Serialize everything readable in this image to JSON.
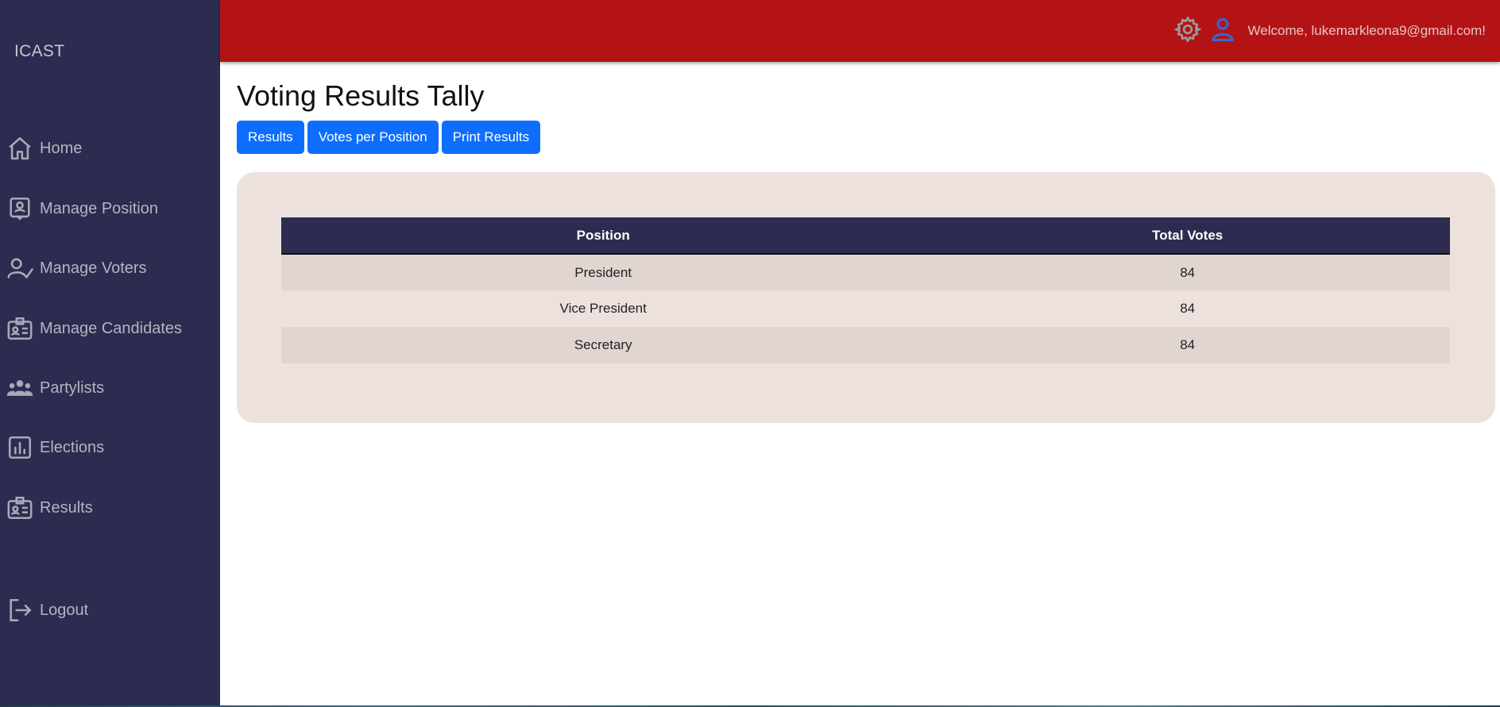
{
  "sidebar": {
    "brand": "ICAST",
    "items": [
      {
        "label": "Home",
        "icon": "home-icon"
      },
      {
        "label": "Manage Position",
        "icon": "position-badge-icon"
      },
      {
        "label": "Manage Voters",
        "icon": "user-check-icon"
      },
      {
        "label": "Manage Candidates",
        "icon": "id-card-icon"
      },
      {
        "label": "Partylists",
        "icon": "group-icon"
      },
      {
        "label": "Elections",
        "icon": "bar-chart-icon"
      },
      {
        "label": "Results",
        "icon": "id-card-icon"
      }
    ],
    "logout": {
      "label": "Logout",
      "icon": "logout-icon"
    }
  },
  "topbar": {
    "settings_icon": "gear-icon",
    "user_icon": "user-icon",
    "welcome_text": "Welcome, lukemarkleona9@gmail.com!",
    "colors": {
      "bar": "#b31315",
      "user_icon": "#2f6bd8"
    }
  },
  "main": {
    "title": "Voting Results Tally",
    "buttons": [
      "Results",
      "Votes per Position",
      "Print Results"
    ],
    "table": {
      "headers": [
        "Position",
        "Total Votes"
      ],
      "rows": [
        {
          "position": "President",
          "votes": "84"
        },
        {
          "position": "Vice President",
          "votes": "84"
        },
        {
          "position": "Secretary",
          "votes": "84"
        }
      ]
    }
  }
}
